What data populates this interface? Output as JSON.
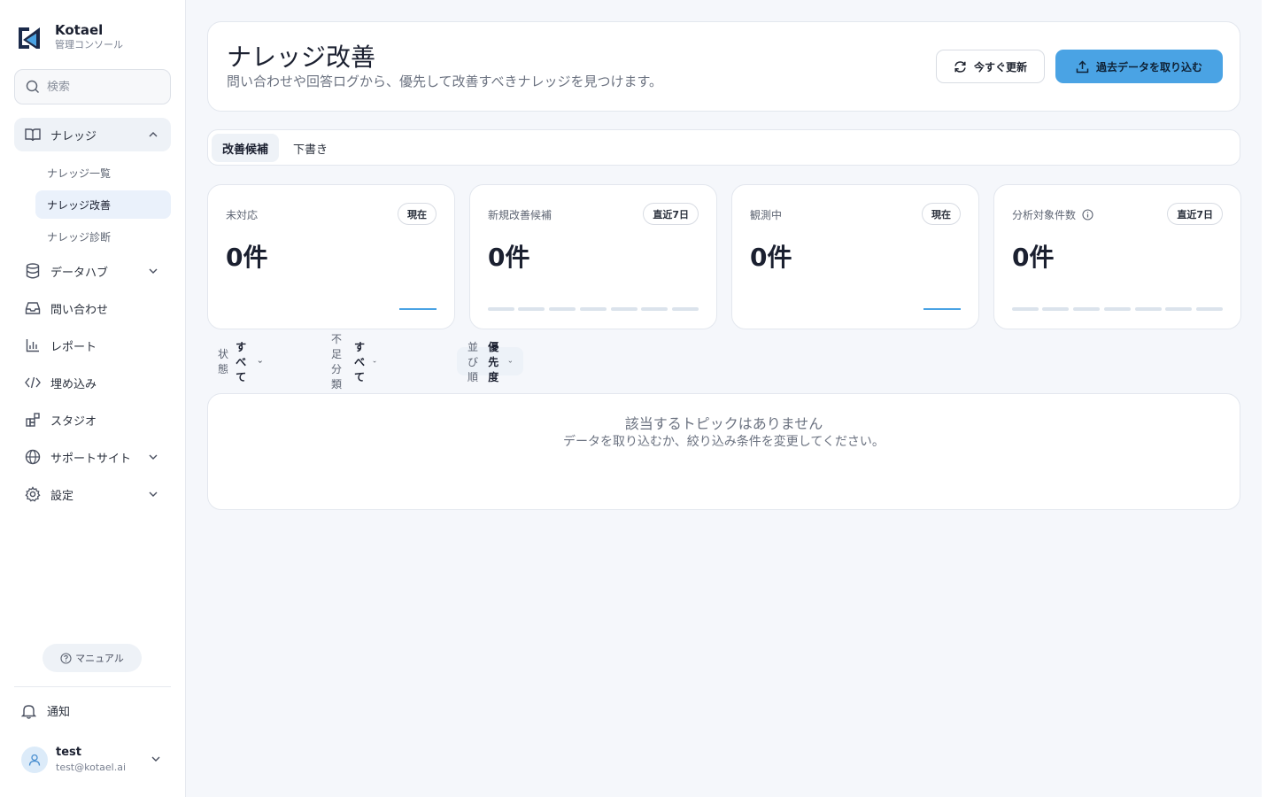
{
  "brand": {
    "name": "Kotael",
    "subtitle": "管理コンソール"
  },
  "search": {
    "placeholder": "検索"
  },
  "sidebar": {
    "items": [
      {
        "label": "ナレッジ",
        "icon": "book-icon"
      },
      {
        "label": "データハブ",
        "icon": "database-icon"
      },
      {
        "label": "問い合わせ",
        "icon": "inbox-icon"
      },
      {
        "label": "レポート",
        "icon": "bar-chart-icon"
      },
      {
        "label": "埋め込み",
        "icon": "code-icon"
      },
      {
        "label": "スタジオ",
        "icon": "blocks-icon"
      },
      {
        "label": "サポートサイト",
        "icon": "globe-icon"
      },
      {
        "label": "設定",
        "icon": "gear-icon"
      }
    ],
    "knowledge_sub": [
      {
        "label": "ナレッジ一覧"
      },
      {
        "label": "ナレッジ改善"
      },
      {
        "label": "ナレッジ診断"
      }
    ],
    "manual_label": "マニュアル",
    "notify_label": "通知"
  },
  "user": {
    "name": "test",
    "email": "test@kotael.ai"
  },
  "header": {
    "title": "ナレッジ改善",
    "description": "問い合わせや回答ログから、優先して改善すべきナレッジを見つけます。",
    "refresh_label": "今すぐ更新",
    "import_label": "過去データを取り込む"
  },
  "tabs": [
    {
      "label": "改善候補"
    },
    {
      "label": "下書き"
    }
  ],
  "stats": [
    {
      "label": "未対応",
      "badge": "現在",
      "value": "0件"
    },
    {
      "label": "新規改善候補",
      "badge": "直近7日",
      "value": "0件"
    },
    {
      "label": "観測中",
      "badge": "現在",
      "value": "0件"
    },
    {
      "label": "分析対象件数",
      "badge": "直近7日",
      "value": "0件"
    }
  ],
  "filters": [
    {
      "label": "状態",
      "value": "すべて"
    },
    {
      "label": "不足分類",
      "value": "すべて"
    },
    {
      "label": "並び順",
      "value": "優先度"
    }
  ],
  "empty": {
    "title": "該当するトピックはありません",
    "description": "データを取り込むか、絞り込み条件を変更してください。"
  },
  "colors": {
    "accent": "#4aa3e4",
    "active_bg": "#eaf1fb"
  }
}
